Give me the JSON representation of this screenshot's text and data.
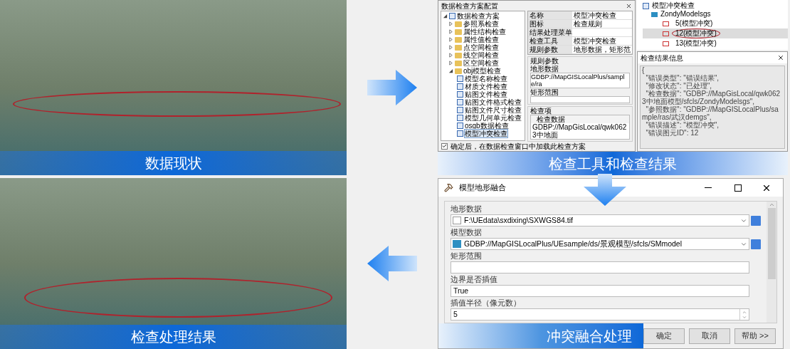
{
  "current_state": {
    "caption": "数据现状"
  },
  "check_config": {
    "window": {
      "title": "数据检查方案配置"
    },
    "tree": {
      "label": "数据检查方案",
      "expanded": true,
      "children": [
        {
          "label": "参照系检查",
          "expanded": false
        },
        {
          "label": "属性结构检查",
          "expanded": false
        },
        {
          "label": "属性值检查",
          "expanded": false
        },
        {
          "label": "点空间检查",
          "expanded": false
        },
        {
          "label": "线空间检查",
          "expanded": false
        },
        {
          "label": "区空间检查",
          "expanded": false
        },
        {
          "label": "obj模型检查",
          "expanded": true,
          "children": [
            {
              "label": "模型名称检查",
              "selected": false
            },
            {
              "label": "材质文件检查",
              "selected": false
            },
            {
              "label": "贴图文件检查",
              "selected": false
            },
            {
              "label": "贴图文件格式检查",
              "selected": false
            },
            {
              "label": "贴图文件尺寸检查",
              "selected": false
            },
            {
              "label": "模型几何单元检查",
              "selected": false
            },
            {
              "label": "osgb数据检查",
              "selected": false
            },
            {
              "label": "模型冲突检查",
              "selected": true
            }
          ]
        }
      ]
    },
    "properties": [
      {
        "name": "名称",
        "value": "模型冲突检查"
      },
      {
        "name": "图标",
        "value": "检查规则"
      },
      {
        "name": "结果处理菜单"
      },
      {
        "name": "检查工具",
        "value": "模型冲突检查"
      },
      {
        "name": "规则参数",
        "value": "地形数据，矩形范"
      }
    ],
    "rule_params": {
      "title": "规则参数",
      "fields": [
        {
          "label": "地形数据",
          "value": "GDBP://MapGISLocalPlus/sample/ra"
        },
        {
          "label": "矩形范围"
        }
      ]
    },
    "check_items": {
      "title": "检查项",
      "column": "检查数据",
      "rows": [
        "GDBP://MapGisLocal/qwk0623中地面"
      ]
    },
    "option": {
      "label": "确定后，在数据检查窗口中加载此检查方案",
      "checked": true
    }
  },
  "results_tree": {
    "label": "模型冲突检查",
    "children": [
      {
        "label": "ZondyModelsgs",
        "children": [
          {
            "label": "5(模型冲突)",
            "selected": false,
            "circled": false
          },
          {
            "label": "12(模型冲突)",
            "selected": true,
            "circled": true
          },
          {
            "label": "13(模型冲突)",
            "selected": false,
            "circled": false
          }
        ]
      }
    ]
  },
  "result_info": {
    "title": "检查结果信息",
    "lines": [
      "{",
      "  \"错误类型\": \"错误结果\",",
      "  \"修改状态\": \"已处理\",",
      "  \"检查数据\": \"GDBP://MapGisLocal/qwk0623中地面模型/sfcls/ZondyModelsgs\",",
      "  \"参照数据\": \"GDBP://MapGISLocalPlus/sample/ras/武汉demgs\",",
      "  \"错误描述\": \"模型冲突\",",
      "  \"错误图元ID\": 12"
    ]
  },
  "check_caption": "检查工具和检查结果",
  "fusion_dialog": {
    "window": {
      "title": "模型地形融合"
    },
    "fields": [
      {
        "kind": "file",
        "label": "地形数据",
        "value": "F:\\UEdata\\sxdixing\\SXWGS84.tif"
      },
      {
        "kind": "file",
        "label": "模型数据",
        "value": "GDBP://MapGISLocalPlus/UEsample/ds/景观模型/sfcls/SMmodel"
      },
      {
        "kind": "text",
        "label": "矩形范围"
      },
      {
        "kind": "text",
        "label": "边界是否插值",
        "value": "True"
      },
      {
        "kind": "spin",
        "label": "插值半径（像元数）",
        "value": "5"
      }
    ],
    "buttons": [
      "确定",
      "取消",
      "帮助 >>"
    ],
    "caption": "冲突融合处理"
  },
  "result": {
    "caption": "检查处理结果"
  }
}
